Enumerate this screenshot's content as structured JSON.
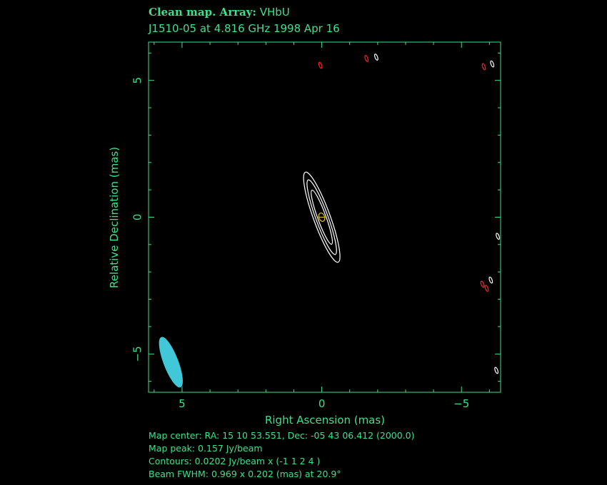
{
  "header": {
    "title_bold": "Clean map.  Array:",
    "array": "VHbU",
    "subtitle": "J1510-05 at 4.816 GHz 1998 Apr 16"
  },
  "colors": {
    "axis": "#3fe08a",
    "positive_contour": "#ffffff",
    "negative_contour": "#ff2020",
    "beam": "#40c8d8",
    "peak_marker": "#e8c020"
  },
  "chart_data": {
    "type": "contour",
    "xlabel": "Right Ascension  (mas)",
    "ylabel": "Relative Declination  (mas)",
    "xlim": [
      6.2,
      -6.4
    ],
    "ylim": [
      -6.4,
      6.4
    ],
    "xticks": [
      5,
      0,
      -5
    ],
    "yticks": [
      5,
      0,
      -5
    ],
    "x_tick_labels": [
      "5",
      "0",
      "−5"
    ],
    "y_tick_labels": [
      "5",
      "0",
      "−5"
    ],
    "minor_tick_step": 1,
    "contour_levels_jy_per_beam": [
      -0.0202,
      0.0202,
      0.0404,
      0.0808
    ],
    "central_component": {
      "x": 0.0,
      "y": 0.0,
      "contours": [
        {
          "level": 0.0202,
          "major": 1.75,
          "minor": 0.3,
          "pa_deg": 20
        },
        {
          "level": 0.0404,
          "major": 1.45,
          "minor": 0.22,
          "pa_deg": 20
        },
        {
          "level": 0.0808,
          "major": 1.05,
          "minor": 0.15,
          "pa_deg": 20
        }
      ],
      "peak_marker": {
        "x": 0.0,
        "y": 0.0
      }
    },
    "noise_contours": [
      {
        "sign": "positive",
        "x": -1.95,
        "y": 5.85
      },
      {
        "sign": "negative",
        "x": -1.6,
        "y": 5.8
      },
      {
        "sign": "negative",
        "x": 0.05,
        "y": 5.55
      },
      {
        "sign": "positive",
        "x": -6.1,
        "y": 5.6
      },
      {
        "sign": "negative",
        "x": -5.8,
        "y": 5.5
      },
      {
        "sign": "positive",
        "x": -6.3,
        "y": -0.7
      },
      {
        "sign": "positive",
        "x": -6.05,
        "y": -2.3
      },
      {
        "sign": "negative",
        "x": -5.75,
        "y": -2.45
      },
      {
        "sign": "negative",
        "x": -5.9,
        "y": -2.6
      },
      {
        "sign": "positive",
        "x": -6.25,
        "y": -5.6
      }
    ],
    "beam": {
      "x": 5.4,
      "y": -5.3,
      "major_mas": 0.969,
      "minor_mas": 0.202,
      "pa_deg": 20.9
    }
  },
  "footer": {
    "map_center": "Map center:  RA: 15 10 53.551,  Dec: -05 43 06.412 (2000.0)",
    "map_peak": "Map peak: 0.157 Jy/beam",
    "contours": "Contours: 0.0202 Jy/beam x (-1 1 2 4 )",
    "beam": "Beam FWHM: 0.969 x 0.202 (mas) at 20.9°"
  }
}
